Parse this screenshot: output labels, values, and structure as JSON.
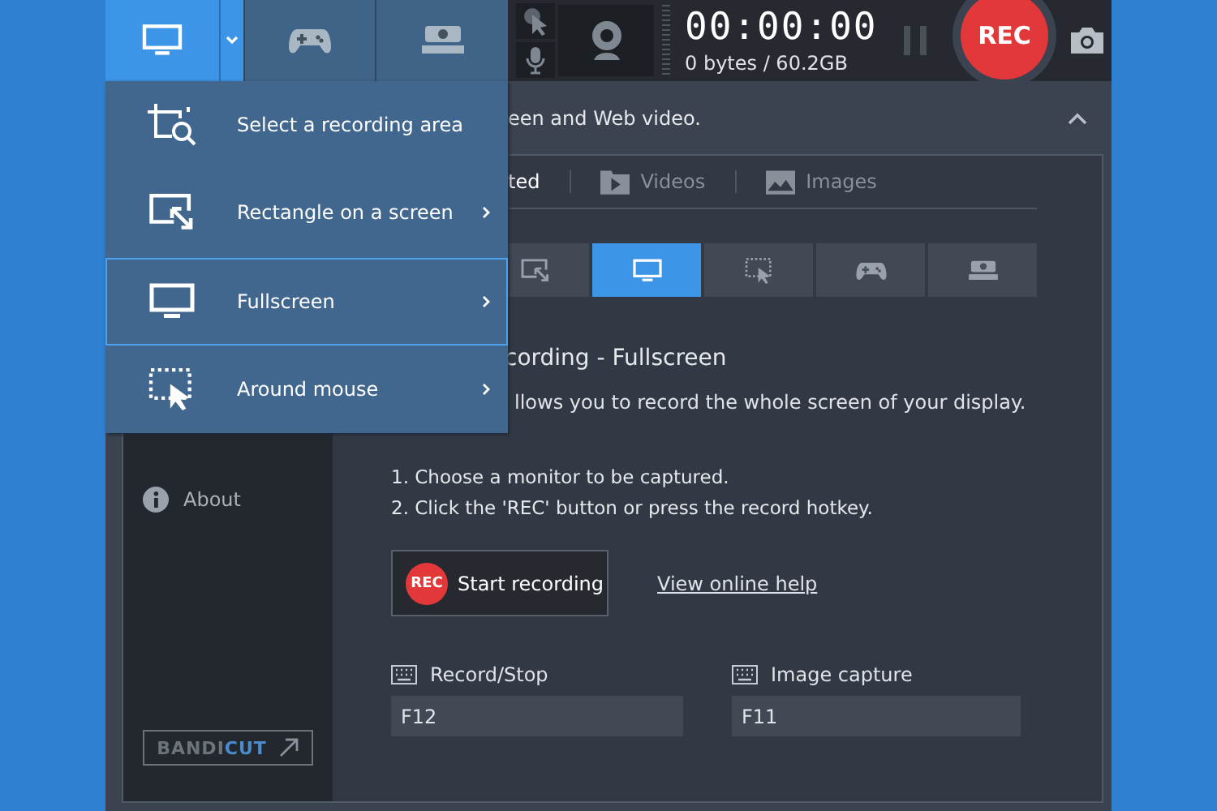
{
  "top_bar": {
    "mode_tabs": [
      {
        "kind": "screen",
        "selected": true,
        "dropdown": true
      },
      {
        "kind": "game",
        "selected": false,
        "dropdown": false
      },
      {
        "kind": "hdmi",
        "selected": false,
        "dropdown": false
      }
    ],
    "timer": "00:00:00",
    "file_size": "0 bytes / 60.2GB",
    "rec_button": "REC"
  },
  "mode_menu": [
    {
      "label": "Select a recording area",
      "kind": "select",
      "submenu": false,
      "selected": false
    },
    {
      "label": "Rectangle on a screen",
      "kind": "rectangle",
      "submenu": true,
      "selected": false
    },
    {
      "label": "Fullscreen",
      "kind": "screen",
      "submenu": true,
      "selected": true
    },
    {
      "label": "Around mouse",
      "kind": "mouse",
      "submenu": true,
      "selected": false
    }
  ],
  "header": {
    "title": "een and Web video."
  },
  "sidebar": {
    "items": [
      {
        "label": "About",
        "kind": "info"
      }
    ],
    "logo": "BANDI**CUT**"
  },
  "content": {
    "tabs": [
      {
        "label": "ted",
        "selected": true
      },
      {
        "label": "Videos",
        "kind": "video",
        "selected": false
      },
      {
        "label": "Images",
        "kind": "image",
        "selected": false
      }
    ],
    "mode_tiles": [
      {
        "kind": "rectangle",
        "selected": false
      },
      {
        "kind": "screen",
        "selected": true
      },
      {
        "kind": "mouse",
        "selected": false
      },
      {
        "kind": "game",
        "selected": false
      },
      {
        "kind": "hdmi",
        "selected": false
      }
    ],
    "heading": "cording - Fullscreen",
    "description": "llows you to record the whole screen of your display.",
    "steps": [
      "1. Choose a monitor to be captured.",
      "2. Click the 'REC' button or press the record hotkey."
    ],
    "start_button": {
      "badge": "REC",
      "label": "Start recording"
    },
    "help_link": "View online help",
    "hotkeys": [
      {
        "label": "Record/Stop",
        "value": "F12"
      },
      {
        "label": "Image capture",
        "value": "F11"
      }
    ]
  }
}
